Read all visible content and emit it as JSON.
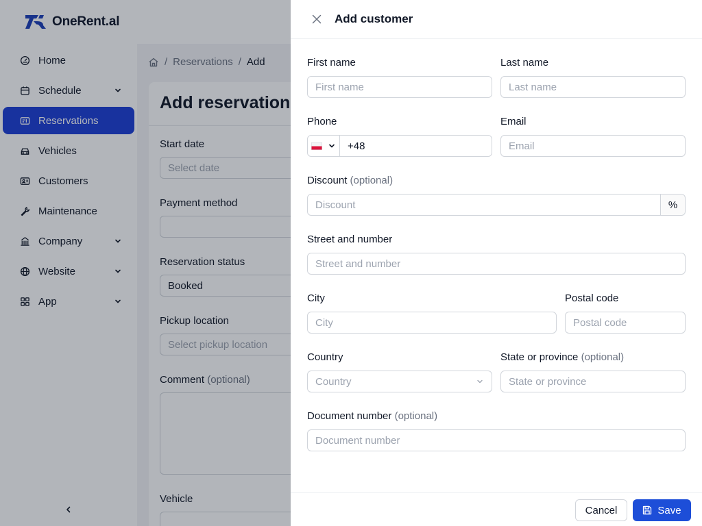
{
  "app": {
    "logo_text": "OneRent.al",
    "accent_color": "#1d4ed8"
  },
  "sidebar": {
    "items": [
      {
        "label": "Home",
        "icon": "gauge-icon",
        "has_submenu": false,
        "active": false
      },
      {
        "label": "Schedule",
        "icon": "calendar-icon",
        "has_submenu": true,
        "active": false
      },
      {
        "label": "Reservations",
        "icon": "reservation-ticket-icon",
        "has_submenu": false,
        "active": true
      },
      {
        "label": "Vehicles",
        "icon": "car-icon",
        "has_submenu": false,
        "active": false
      },
      {
        "label": "Customers",
        "icon": "id-card-icon",
        "has_submenu": false,
        "active": false
      },
      {
        "label": "Maintenance",
        "icon": "wrench-icon",
        "has_submenu": false,
        "active": false
      },
      {
        "label": "Company",
        "icon": "building-icon",
        "has_submenu": true,
        "active": false
      },
      {
        "label": "Website",
        "icon": "globe-icon",
        "has_submenu": true,
        "active": false
      },
      {
        "label": "App",
        "icon": "grid-icon",
        "has_submenu": true,
        "active": false
      }
    ]
  },
  "breadcrumb": {
    "section": "Reservations",
    "current": "Add",
    "separator": "/"
  },
  "reservation_form": {
    "title": "Add reservation",
    "start_date_label": "Start date",
    "start_date_placeholder": "Select date",
    "payment_method_label": "Payment method",
    "reservation_status_label": "Reservation status",
    "reservation_status_value": "Booked",
    "pickup_location_label": "Pickup location",
    "pickup_location_placeholder": "Select pickup location",
    "comment_label": "Comment",
    "optional_text": "(optional)",
    "vehicle_label": "Vehicle"
  },
  "drawer": {
    "title": "Add customer",
    "optional_text": "(optional)",
    "fields": {
      "first_name": {
        "label": "First name",
        "placeholder": "First name"
      },
      "last_name": {
        "label": "Last name",
        "placeholder": "Last name"
      },
      "phone": {
        "label": "Phone",
        "value": "+48",
        "country_flag": "poland-flag"
      },
      "email": {
        "label": "Email",
        "placeholder": "Email"
      },
      "discount": {
        "label": "Discount",
        "placeholder": "Discount",
        "suffix": "%"
      },
      "street": {
        "label": "Street and number",
        "placeholder": "Street and number"
      },
      "city": {
        "label": "City",
        "placeholder": "City"
      },
      "postal_code": {
        "label": "Postal code",
        "placeholder": "Postal code"
      },
      "country": {
        "label": "Country",
        "placeholder": "Country"
      },
      "state": {
        "label": "State or province",
        "placeholder": "State or province"
      },
      "document_number": {
        "label": "Document number",
        "placeholder": "Document number"
      }
    },
    "footer": {
      "cancel_label": "Cancel",
      "save_label": "Save"
    }
  }
}
